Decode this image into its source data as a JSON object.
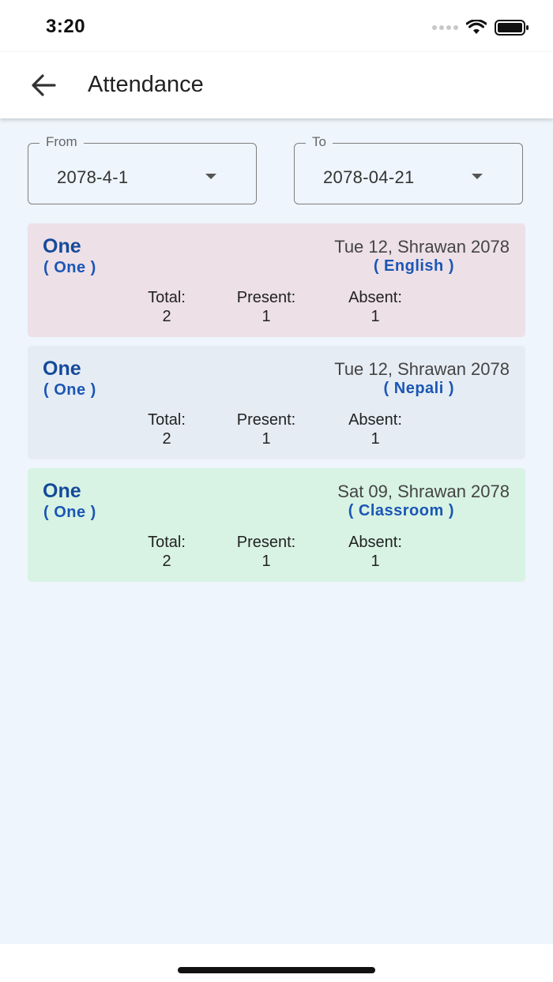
{
  "status_bar": {
    "time": "3:20"
  },
  "header": {
    "title": "Attendance"
  },
  "filters": {
    "from": {
      "label": "From",
      "value": "2078-4-1"
    },
    "to": {
      "label": "To",
      "value": "2078-04-21"
    }
  },
  "records": [
    {
      "class_name": "One",
      "section": "( One )",
      "date": "Tue 12, Shrawan 2078",
      "subject": "( English )",
      "total_label": "Total:",
      "total": "2",
      "present_label": "Present:",
      "present": "1",
      "absent_label": "Absent:",
      "absent": "1",
      "background": "#ede0e7"
    },
    {
      "class_name": "One",
      "section": "( One )",
      "date": "Tue 12, Shrawan 2078",
      "subject": "( Nepali )",
      "total_label": "Total:",
      "total": "2",
      "present_label": "Present:",
      "present": "1",
      "absent_label": "Absent:",
      "absent": "1",
      "background": "#e6ecf4"
    },
    {
      "class_name": "One",
      "section": "( One )",
      "date": "Sat 09, Shrawan 2078",
      "subject": "( Classroom )",
      "total_label": "Total:",
      "total": "2",
      "present_label": "Present:",
      "present": "1",
      "absent_label": "Absent:",
      "absent": "1",
      "background": "#d8f3e4"
    }
  ],
  "colors": {
    "page_background": "#eef5fc",
    "accent": "#154a9a"
  }
}
